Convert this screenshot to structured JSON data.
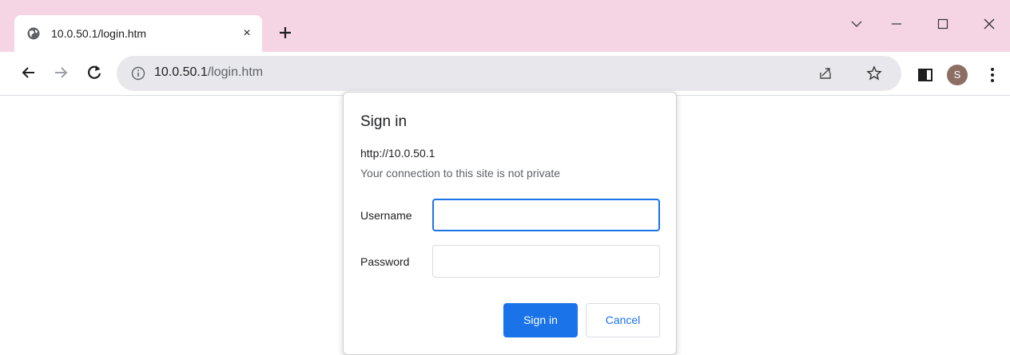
{
  "browser": {
    "tab": {
      "title": "10.0.50.1/login.htm",
      "close_label": "×",
      "favicon": "globe-icon"
    },
    "new_tab_icon": "plus-icon",
    "window_controls": [
      "chevron-down-icon",
      "minimize-icon",
      "maximize-icon",
      "close-icon"
    ],
    "toolbar": {
      "url_host": "10.0.50.1",
      "url_path": "/login.htm",
      "avatar_initial": "S",
      "avatar_color": "#8d6e63"
    },
    "colors": {
      "tabstrip": "#f5d4e4",
      "omnibox": "#e8e8ec",
      "accent": "#1a73e8"
    }
  },
  "dialog": {
    "title": "Sign in",
    "origin": "http://10.0.50.1",
    "warning": "Your connection to this site is not private",
    "username_label": "Username",
    "username_value": "",
    "password_label": "Password",
    "password_value": "",
    "sign_in_label": "Sign in",
    "cancel_label": "Cancel"
  }
}
